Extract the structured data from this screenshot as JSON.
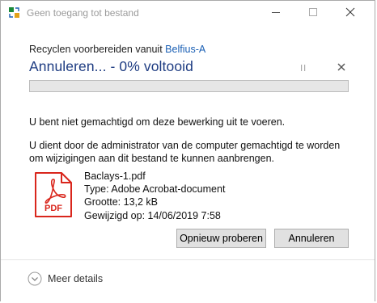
{
  "window": {
    "title": "Geen toegang tot bestand"
  },
  "operation": {
    "prefix": "Recyclen voorbereiden vanuit",
    "location": "Belfius-A",
    "heading": "Annuleren... - 0% voltooid",
    "progress_percent": 0
  },
  "messages": {
    "line1": "U bent niet gemachtigd om deze bewerking uit te voeren.",
    "line2": "U dient door de administrator van de computer gemachtigd te worden om wijzigingen aan dit bestand te kunnen aanbrengen."
  },
  "file": {
    "icon_label": "PDF",
    "name": "Baclays-1.pdf",
    "type": "Type: Adobe Acrobat-document",
    "size": "Grootte: 13,2 kB",
    "modified": "Gewijzigd op: 14/06/2019 7:58"
  },
  "buttons": {
    "retry": "Opnieuw proberen",
    "cancel": "Annuleren"
  },
  "footer": {
    "more_details": "Meer details"
  },
  "colors": {
    "heading": "#1e3c82",
    "link": "#1a5fb4",
    "pdf_red": "#d9261c",
    "progress_green": "#06b025"
  }
}
